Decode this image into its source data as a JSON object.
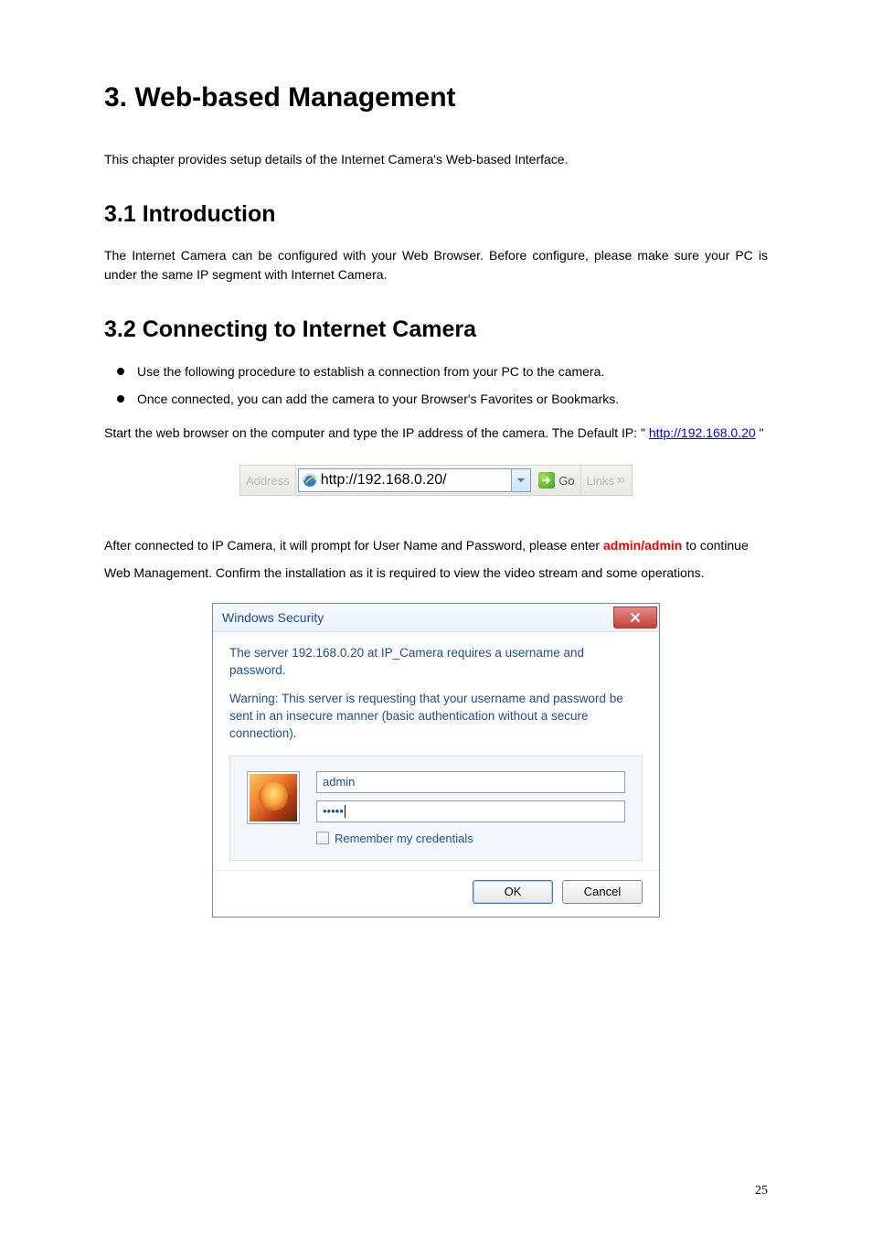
{
  "heading_main": "3. Web-based Management",
  "intro_paragraph": "This chapter provides setup details of the Internet Camera's Web-based Interface.",
  "section_3_1_title": "3.1 Introduction",
  "section_3_1_body": "The Internet Camera can be configured with your Web Browser. Before configure, please make sure your PC is under the same IP segment with Internet Camera.",
  "section_3_2_title": "3.2 Connecting to Internet Camera",
  "bullets": [
    "Use the following procedure to establish a connection from your PC to the camera.",
    "Once connected, you can add the camera to your Browser's Favorites or Bookmarks."
  ],
  "start_browser_text_pre": "Start the web browser on the computer and type the IP address of the camera. The Default IP: \" ",
  "ip_link_text": "http://192.168.0.20",
  "start_browser_text_post": " \"",
  "addressbar": {
    "label": "Address",
    "url": "http://192.168.0.20/",
    "go_label": "Go",
    "links_label": "Links"
  },
  "after_connect_pre": "After connected to IP Camera, it will prompt for User Name and Password, please enter ",
  "admin_admin": "admin/admin",
  "after_connect_post": " to continue Web Management. Confirm the installation as it is required to view the video stream and some operations.",
  "dialog": {
    "title": "Windows Security",
    "line1": "The server 192.168.0.20 at IP_Camera requires a username and password.",
    "line2": "Warning: This server is requesting that your username and password be sent in an insecure manner (basic authentication without a secure connection).",
    "username_value": "admin",
    "password_mask": "•••••",
    "remember_label": "Remember my credentials",
    "ok_label": "OK",
    "cancel_label": "Cancel"
  },
  "page_number": "25"
}
